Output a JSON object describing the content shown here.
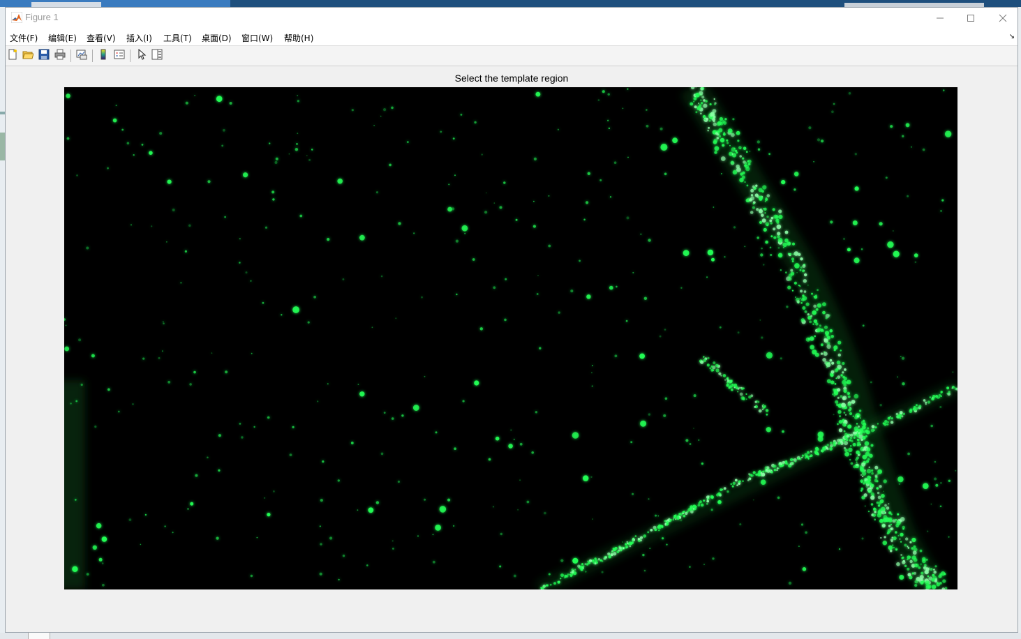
{
  "window": {
    "title": "Figure 1"
  },
  "menu": [
    {
      "label": "文件(F)"
    },
    {
      "label": "编辑(E)"
    },
    {
      "label": "查看(V)"
    },
    {
      "label": "插入(I)"
    },
    {
      "label": "工具(T)"
    },
    {
      "label": "桌面(D)"
    },
    {
      "label": "窗口(W)"
    },
    {
      "label": "帮助(H)"
    }
  ],
  "toolbar": [
    {
      "icon": "new-figure-icon"
    },
    {
      "icon": "open-file-icon"
    },
    {
      "icon": "save-icon"
    },
    {
      "icon": "print-icon"
    },
    {
      "icon": "link-plot-icon"
    },
    {
      "icon": "insert-colorbar-icon"
    },
    {
      "icon": "insert-legend-icon"
    },
    {
      "icon": "edit-plot-arrow-icon"
    },
    {
      "icon": "property-inspector-icon"
    }
  ],
  "figure": {
    "title": "Select the template region",
    "image_description_colors": {
      "background": "#000000",
      "signal": "#22ff55"
    }
  }
}
